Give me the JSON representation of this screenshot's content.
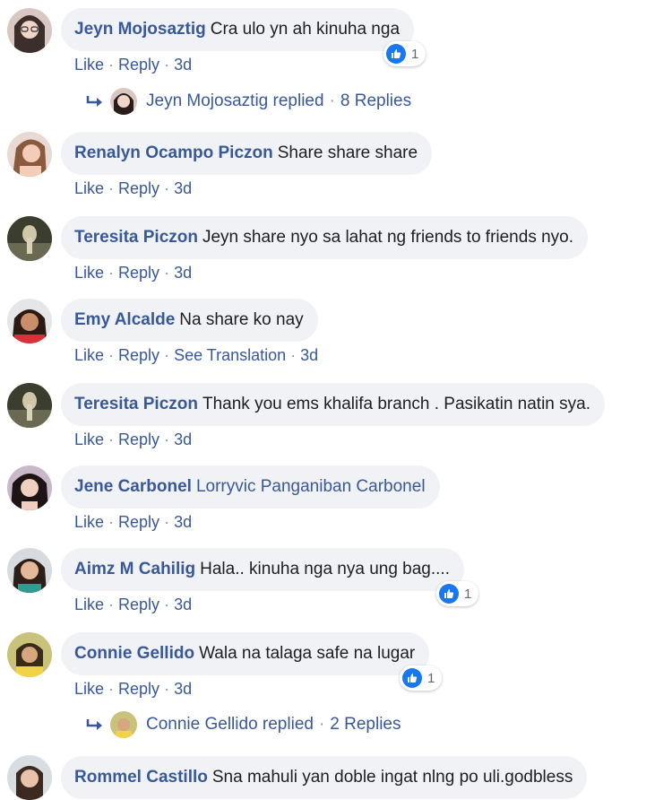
{
  "comments": [
    {
      "author": "Jeyn Mojosaztig",
      "text": "Cra ulo yn ah kinuha nga",
      "actions": [
        "Like",
        "Reply"
      ],
      "time": "3d",
      "reaction": "1",
      "replies": {
        "by": "Jeyn Mojosaztig replied",
        "count": "8 Replies"
      }
    },
    {
      "author": "Renalyn Ocampo Piczon",
      "text": "Share share share",
      "actions": [
        "Like",
        "Reply"
      ],
      "time": "3d"
    },
    {
      "author": "Teresita Piczon",
      "text": "Jeyn share nyo sa lahat ng friends to friends nyo.",
      "actions": [
        "Like",
        "Reply"
      ],
      "time": "3d"
    },
    {
      "author": "Emy Alcalde",
      "text": "Na share ko nay",
      "actions": [
        "Like",
        "Reply",
        "See Translation"
      ],
      "time": "3d"
    },
    {
      "author": "Teresita Piczon",
      "text": "Thank you ems khalifa branch . Pasikatin natin sya.",
      "actions": [
        "Like",
        "Reply"
      ],
      "time": "3d"
    },
    {
      "author": "Jene Carbonel",
      "text": "Lorryvic Panganiban Carbonel",
      "actions": [
        "Like",
        "Reply"
      ],
      "time": "3d"
    },
    {
      "author": "Aimz M Cahilig",
      "text": "Hala.. kinuha nga nya ung bag....",
      "actions": [
        "Like",
        "Reply"
      ],
      "time": "3d",
      "reaction": "1"
    },
    {
      "author": "Connie Gellido",
      "text": "Wala na talaga safe na lugar",
      "actions": [
        "Like",
        "Reply"
      ],
      "time": "3d",
      "reaction": "1",
      "replies": {
        "by": "Connie Gellido replied",
        "count": "2 Replies"
      }
    },
    {
      "author": "Rommel Castillo",
      "text": "Sna mahuli yan doble ingat nlng po uli.godbless"
    }
  ],
  "colors": {
    "link": "#385898",
    "bubble": "#f0f2f5",
    "like": "#1877f2",
    "text": "#1c1e21"
  }
}
